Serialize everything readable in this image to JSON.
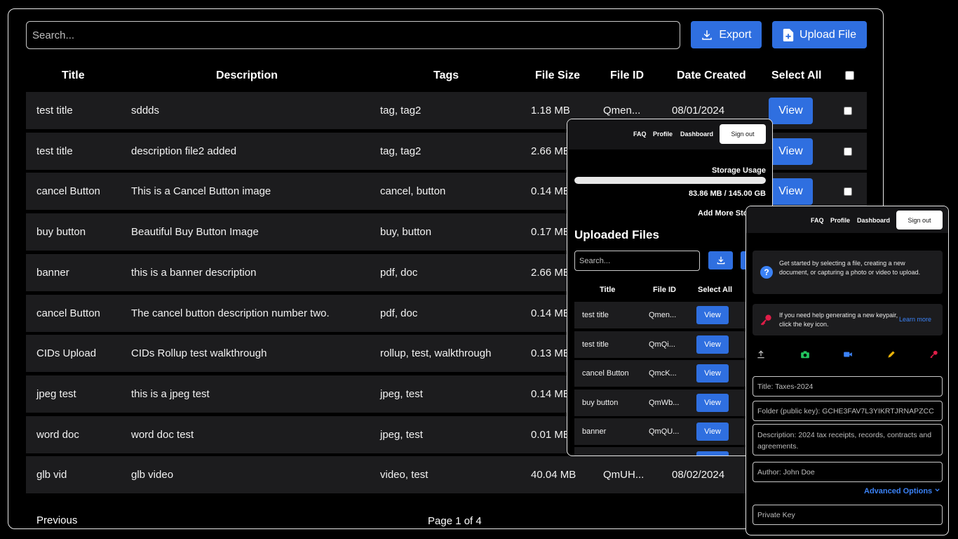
{
  "main": {
    "search_placeholder": "Search...",
    "export_label": "Export",
    "upload_label": "Upload File",
    "columns": [
      "Title",
      "Description",
      "Tags",
      "File Size",
      "File ID",
      "Date Created",
      "Select All"
    ],
    "rows": [
      {
        "title": "test title",
        "description": "sddds",
        "tags": "tag, tag2",
        "size": "1.18 MB",
        "id": "Qmen...",
        "date": "08/01/2024"
      },
      {
        "title": "test title",
        "description": "description file2 added",
        "tags": "tag, tag2",
        "size": "2.66 MB",
        "id": "",
        "date": ""
      },
      {
        "title": "cancel Button",
        "description": "This is a Cancel Button image",
        "tags": "cancel, button",
        "size": "0.14 MB",
        "id": "",
        "date": ""
      },
      {
        "title": "buy button",
        "description": "Beautiful Buy Button Image",
        "tags": "buy, button",
        "size": "0.17 MB",
        "id": "",
        "date": ""
      },
      {
        "title": "banner",
        "description": "this is a banner description",
        "tags": "pdf, doc",
        "size": "2.66 MB",
        "id": "",
        "date": ""
      },
      {
        "title": "cancel Button",
        "description": "The cancel button description number two.",
        "tags": "pdf, doc",
        "size": "0.14 MB",
        "id": "",
        "date": ""
      },
      {
        "title": "CIDs Upload",
        "description": "CIDs Rollup test walkthrough",
        "tags": "rollup, test, walkthrough",
        "size": "0.13 MB",
        "id": "",
        "date": ""
      },
      {
        "title": "jpeg test",
        "description": "this is a jpeg test",
        "tags": "jpeg, test",
        "size": "0.14 MB",
        "id": "",
        "date": ""
      },
      {
        "title": "word doc",
        "description": "word doc test",
        "tags": "jpeg, test",
        "size": "0.01 MB",
        "id": "",
        "date": ""
      },
      {
        "title": "glb vid",
        "description": "glb video",
        "tags": "video, test",
        "size": "40.04 MB",
        "id": "QmUH...",
        "date": "08/02/2024"
      }
    ],
    "view_label": "View",
    "previous_label": "Previous",
    "page_indicator": "Page 1 of 4"
  },
  "tablet": {
    "nav": {
      "faq": "FAQ",
      "profile": "Profile",
      "dashboard": "Dashboard",
      "signout": "Sign out"
    },
    "storage_label": "Storage Usage",
    "storage_value": "83.86 MB / 145.00 GB",
    "storage_fraction": 0.999,
    "add_storage": "Add More Sto",
    "heading": "Uploaded Files",
    "search_placeholder": "Search...",
    "columns": [
      "Title",
      "File ID",
      "Select All"
    ],
    "rows": [
      {
        "title": "test title",
        "id": "Qmen..."
      },
      {
        "title": "test title",
        "id": "QmQi..."
      },
      {
        "title": "cancel Button",
        "id": "QmcK..."
      },
      {
        "title": "buy button",
        "id": "QmWb..."
      },
      {
        "title": "banner",
        "id": "QmQU..."
      }
    ],
    "view_label": "View"
  },
  "phone": {
    "nav": {
      "faq": "FAQ",
      "profile": "Profile",
      "dashboard": "Dashboard",
      "signout": "Sign out"
    },
    "help_text": "Get started by selecting a file, creating a new document, or capturing a photo or video to upload.",
    "keypair_text": "If you need help generating a new keypair, click the key icon.",
    "learn_more": "Learn more",
    "title_field": "Title: Taxes-2024",
    "folder_field": "Folder (public key): GCHE3FAV7L3YIKRTJRNAPZCC",
    "description_field": "Description: 2024 tax receipts, records, contracts and agreements.",
    "author_field": "Author: John Doe",
    "advanced_label": "Advanced Options",
    "private_key_placeholder": "Private Key"
  },
  "colors": {
    "accent_blue": "#2f6fe0",
    "row_bg": "#1c1c1e",
    "link_blue": "#3b82f6",
    "key_red": "#e11d48",
    "camera_green": "#22c55e",
    "video_blue": "#3b82f6",
    "pencil_yellow": "#eab308"
  }
}
